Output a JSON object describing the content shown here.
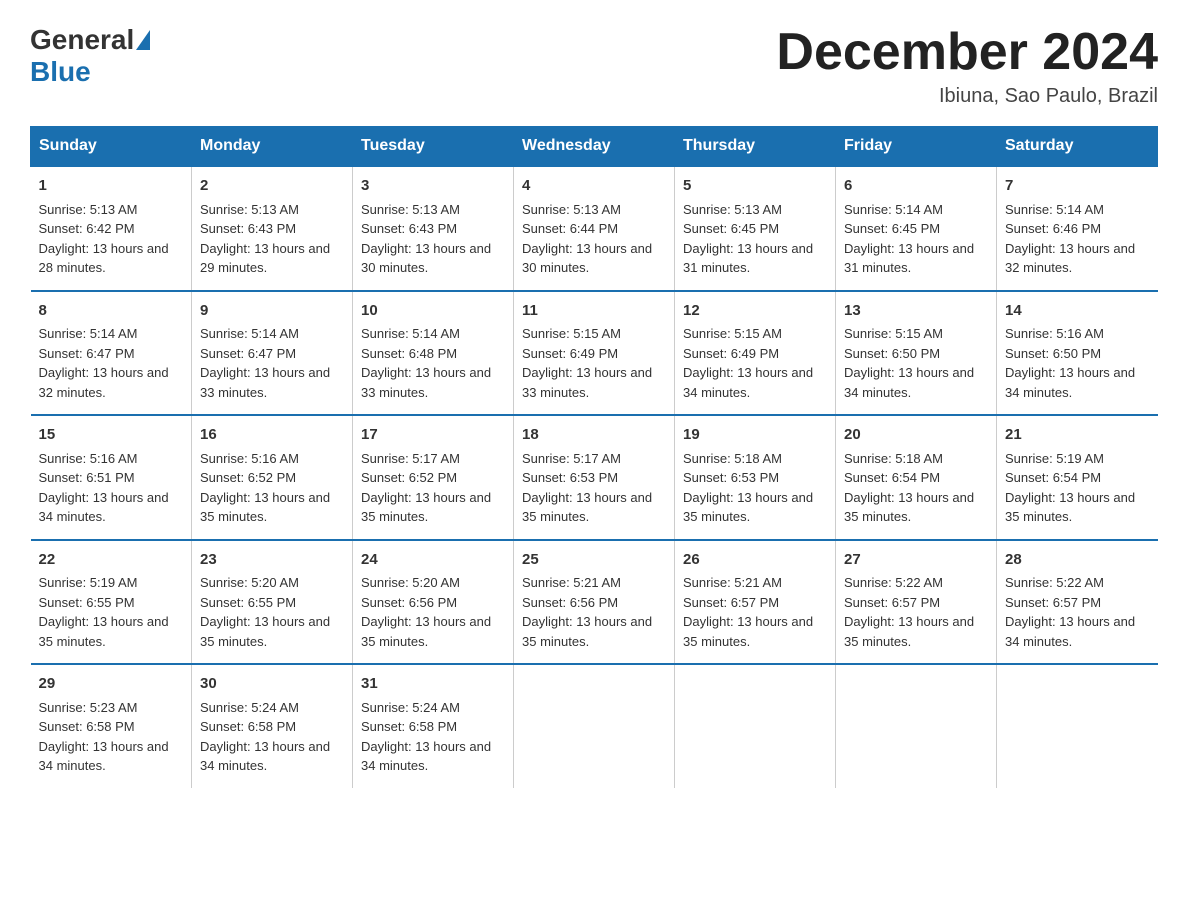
{
  "header": {
    "logo_general": "General",
    "logo_blue": "Blue",
    "month_title": "December 2024",
    "subtitle": "Ibiuna, Sao Paulo, Brazil"
  },
  "days_of_week": [
    "Sunday",
    "Monday",
    "Tuesday",
    "Wednesday",
    "Thursday",
    "Friday",
    "Saturday"
  ],
  "weeks": [
    [
      {
        "day": "1",
        "sunrise": "5:13 AM",
        "sunset": "6:42 PM",
        "daylight": "13 hours and 28 minutes."
      },
      {
        "day": "2",
        "sunrise": "5:13 AM",
        "sunset": "6:43 PM",
        "daylight": "13 hours and 29 minutes."
      },
      {
        "day": "3",
        "sunrise": "5:13 AM",
        "sunset": "6:43 PM",
        "daylight": "13 hours and 30 minutes."
      },
      {
        "day": "4",
        "sunrise": "5:13 AM",
        "sunset": "6:44 PM",
        "daylight": "13 hours and 30 minutes."
      },
      {
        "day": "5",
        "sunrise": "5:13 AM",
        "sunset": "6:45 PM",
        "daylight": "13 hours and 31 minutes."
      },
      {
        "day": "6",
        "sunrise": "5:14 AM",
        "sunset": "6:45 PM",
        "daylight": "13 hours and 31 minutes."
      },
      {
        "day": "7",
        "sunrise": "5:14 AM",
        "sunset": "6:46 PM",
        "daylight": "13 hours and 32 minutes."
      }
    ],
    [
      {
        "day": "8",
        "sunrise": "5:14 AM",
        "sunset": "6:47 PM",
        "daylight": "13 hours and 32 minutes."
      },
      {
        "day": "9",
        "sunrise": "5:14 AM",
        "sunset": "6:47 PM",
        "daylight": "13 hours and 33 minutes."
      },
      {
        "day": "10",
        "sunrise": "5:14 AM",
        "sunset": "6:48 PM",
        "daylight": "13 hours and 33 minutes."
      },
      {
        "day": "11",
        "sunrise": "5:15 AM",
        "sunset": "6:49 PM",
        "daylight": "13 hours and 33 minutes."
      },
      {
        "day": "12",
        "sunrise": "5:15 AM",
        "sunset": "6:49 PM",
        "daylight": "13 hours and 34 minutes."
      },
      {
        "day": "13",
        "sunrise": "5:15 AM",
        "sunset": "6:50 PM",
        "daylight": "13 hours and 34 minutes."
      },
      {
        "day": "14",
        "sunrise": "5:16 AM",
        "sunset": "6:50 PM",
        "daylight": "13 hours and 34 minutes."
      }
    ],
    [
      {
        "day": "15",
        "sunrise": "5:16 AM",
        "sunset": "6:51 PM",
        "daylight": "13 hours and 34 minutes."
      },
      {
        "day": "16",
        "sunrise": "5:16 AM",
        "sunset": "6:52 PM",
        "daylight": "13 hours and 35 minutes."
      },
      {
        "day": "17",
        "sunrise": "5:17 AM",
        "sunset": "6:52 PM",
        "daylight": "13 hours and 35 minutes."
      },
      {
        "day": "18",
        "sunrise": "5:17 AM",
        "sunset": "6:53 PM",
        "daylight": "13 hours and 35 minutes."
      },
      {
        "day": "19",
        "sunrise": "5:18 AM",
        "sunset": "6:53 PM",
        "daylight": "13 hours and 35 minutes."
      },
      {
        "day": "20",
        "sunrise": "5:18 AM",
        "sunset": "6:54 PM",
        "daylight": "13 hours and 35 minutes."
      },
      {
        "day": "21",
        "sunrise": "5:19 AM",
        "sunset": "6:54 PM",
        "daylight": "13 hours and 35 minutes."
      }
    ],
    [
      {
        "day": "22",
        "sunrise": "5:19 AM",
        "sunset": "6:55 PM",
        "daylight": "13 hours and 35 minutes."
      },
      {
        "day": "23",
        "sunrise": "5:20 AM",
        "sunset": "6:55 PM",
        "daylight": "13 hours and 35 minutes."
      },
      {
        "day": "24",
        "sunrise": "5:20 AM",
        "sunset": "6:56 PM",
        "daylight": "13 hours and 35 minutes."
      },
      {
        "day": "25",
        "sunrise": "5:21 AM",
        "sunset": "6:56 PM",
        "daylight": "13 hours and 35 minutes."
      },
      {
        "day": "26",
        "sunrise": "5:21 AM",
        "sunset": "6:57 PM",
        "daylight": "13 hours and 35 minutes."
      },
      {
        "day": "27",
        "sunrise": "5:22 AM",
        "sunset": "6:57 PM",
        "daylight": "13 hours and 35 minutes."
      },
      {
        "day": "28",
        "sunrise": "5:22 AM",
        "sunset": "6:57 PM",
        "daylight": "13 hours and 34 minutes."
      }
    ],
    [
      {
        "day": "29",
        "sunrise": "5:23 AM",
        "sunset": "6:58 PM",
        "daylight": "13 hours and 34 minutes."
      },
      {
        "day": "30",
        "sunrise": "5:24 AM",
        "sunset": "6:58 PM",
        "daylight": "13 hours and 34 minutes."
      },
      {
        "day": "31",
        "sunrise": "5:24 AM",
        "sunset": "6:58 PM",
        "daylight": "13 hours and 34 minutes."
      },
      null,
      null,
      null,
      null
    ]
  ]
}
